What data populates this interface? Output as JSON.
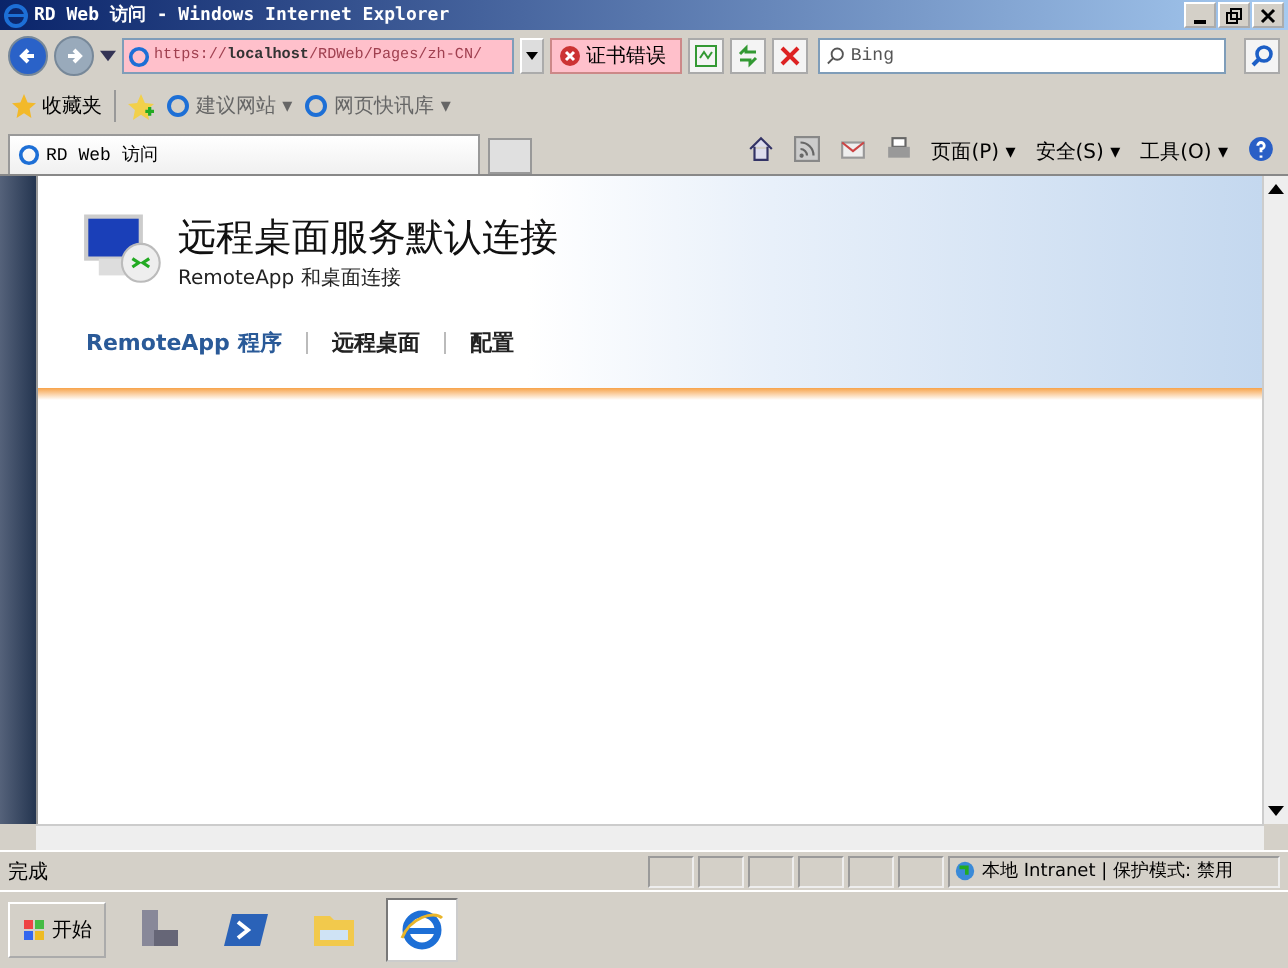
{
  "window": {
    "title": "RD Web 访问 - Windows Internet Explorer"
  },
  "address_bar": {
    "url_prefix": "https://",
    "url_host": "localhost",
    "url_path": "/RDWeb/Pages/zh-CN/",
    "cert_error": "证书错误"
  },
  "search": {
    "placeholder": "Bing"
  },
  "favorites_bar": {
    "favorites": "收藏夹",
    "links": [
      {
        "label": "建议网站 ▾"
      },
      {
        "label": "网页快讯库 ▾"
      }
    ]
  },
  "tabs": [
    {
      "label": "RD Web 访问",
      "selected": true
    }
  ],
  "command_bar": {
    "menus": [
      {
        "label": "页面(P) ▾"
      },
      {
        "label": "安全(S) ▾"
      },
      {
        "label": "工具(O) ▾"
      }
    ]
  },
  "page": {
    "title": "远程桌面服务默认连接",
    "subtitle": "RemoteApp 和桌面连接",
    "nav": [
      {
        "label": "RemoteApp 程序",
        "selected": true
      },
      {
        "label": "远程桌面",
        "selected": false
      },
      {
        "label": "配置",
        "selected": false
      }
    ]
  },
  "status_bar": {
    "status": "完成",
    "zone": "本地 Intranet | 保护模式: 禁用"
  },
  "taskbar": {
    "start": "开始",
    "apps": [
      {
        "kind": "server",
        "selected": false
      },
      {
        "kind": "powershell",
        "selected": false
      },
      {
        "kind": "folder",
        "selected": false
      },
      {
        "kind": "ie",
        "selected": true
      }
    ]
  }
}
